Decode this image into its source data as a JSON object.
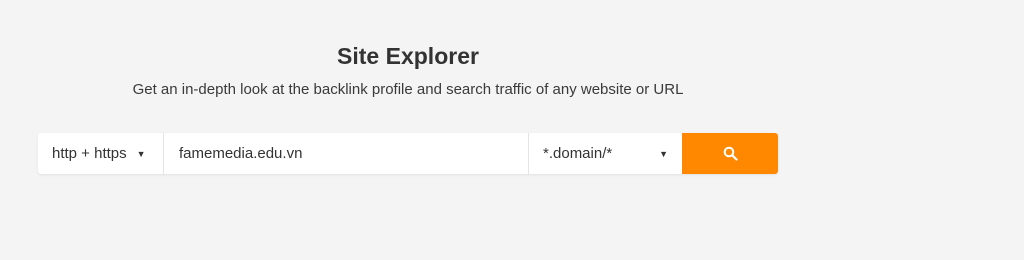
{
  "header": {
    "title": "Site Explorer",
    "subtitle": "Get an in-depth look at the backlink profile and search traffic of any website or URL"
  },
  "search": {
    "protocol": "http + https",
    "target_value": "famemedia.edu.vn",
    "mode": "*.domain/*",
    "button_icon": "search-icon",
    "accent_color": "#ff8800"
  }
}
